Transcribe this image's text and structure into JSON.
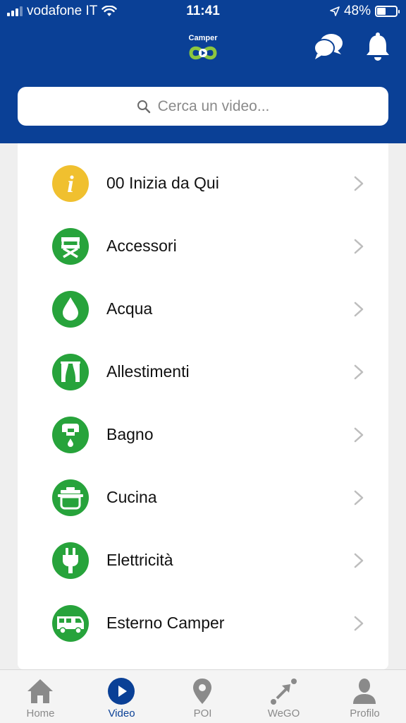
{
  "status_bar": {
    "carrier": "vodafone IT",
    "time": "11:41",
    "battery": "48%",
    "battery_level": 0.48
  },
  "header": {
    "logo_text": "Camper",
    "logo_icon": "infinity-play-icon",
    "chat_icon": "chat-bubbles-icon",
    "bell_icon": "bell-icon"
  },
  "search": {
    "placeholder": "Cerca un video...",
    "icon": "search-icon"
  },
  "categories": [
    {
      "label": "00 Inizia da Qui",
      "icon": "info-icon",
      "color": "#f0c02f"
    },
    {
      "label": "Accessori",
      "icon": "director-chair-icon",
      "color": "#27a33b"
    },
    {
      "label": "Acqua",
      "icon": "water-drop-icon",
      "color": "#27a33b"
    },
    {
      "label": "Allestimenti",
      "icon": "curtains-icon",
      "color": "#27a33b"
    },
    {
      "label": "Bagno",
      "icon": "faucet-icon",
      "color": "#27a33b"
    },
    {
      "label": "Cucina",
      "icon": "cooking-pot-icon",
      "color": "#27a33b"
    },
    {
      "label": "Elettricità",
      "icon": "plug-icon",
      "color": "#27a33b"
    },
    {
      "label": "Esterno Camper",
      "icon": "camper-van-icon",
      "color": "#27a33b"
    }
  ],
  "tabs": [
    {
      "label": "Home",
      "icon": "home-icon",
      "active": false
    },
    {
      "label": "Video",
      "icon": "play-icon",
      "active": true
    },
    {
      "label": "POI",
      "icon": "map-pin-icon",
      "active": false
    },
    {
      "label": "WeGO",
      "icon": "route-arrow-icon",
      "active": false
    },
    {
      "label": "Profilo",
      "icon": "user-icon",
      "active": false
    }
  ],
  "colors": {
    "header_bg": "#0a4096",
    "accent_green": "#27a33b",
    "accent_yellow": "#f0c02f",
    "tab_active": "#0a4096",
    "tab_inactive": "#8a8a8a"
  }
}
